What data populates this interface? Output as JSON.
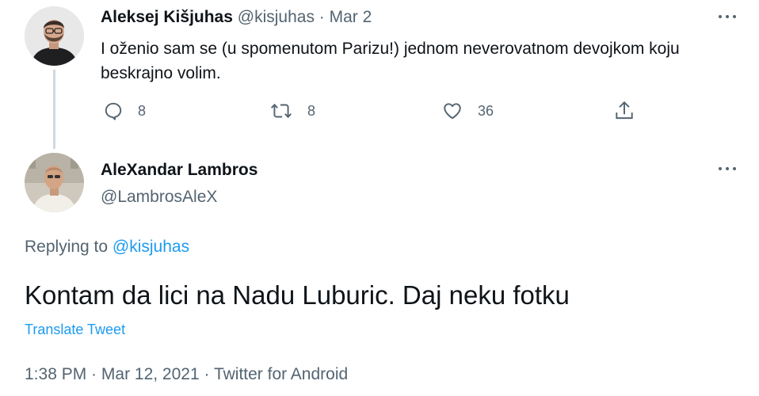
{
  "parent_tweet": {
    "author_name": "Aleksej Kišjuhas",
    "handle": "@kisjuhas",
    "separator": " · ",
    "date": "Mar 2",
    "text": "I oženio sam se (u spomenutom Parizu!) jednom neverovatnom devojkom koju beskrajno volim.",
    "replies": "8",
    "retweets": "8",
    "likes": "36",
    "icons": [
      "reply-icon",
      "retweet-icon",
      "like-icon",
      "share-icon",
      "more-icon"
    ]
  },
  "main_tweet": {
    "author_name": "AleXandar Lambros",
    "handle": "@LambrosAleX",
    "replying_prefix": "Replying to ",
    "replying_to": "@kisjuhas",
    "text": "Kontam da lici na Nadu Luburic. Daj neku fotku",
    "translate_label": "Translate Tweet",
    "time": "1:38 PM",
    "separator": " · ",
    "date": "Mar 12, 2021",
    "source": "Twitter for Android"
  },
  "colors": {
    "text_primary": "#0f1419",
    "text_secondary": "#536471",
    "link": "#1d9bf0",
    "thread_line": "#cfd9de"
  }
}
